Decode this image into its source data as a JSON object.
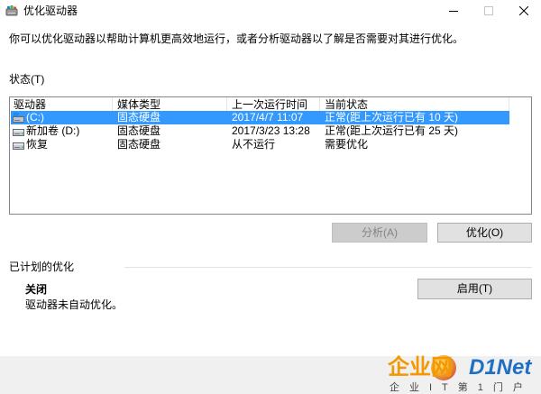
{
  "window": {
    "title": "优化驱动器",
    "icon": "optimize-drives-icon",
    "controls": [
      "minimize-icon",
      "maximize-icon",
      "close-icon"
    ]
  },
  "description": "你可以优化驱动器以帮助计算机更高效地运行，或者分析驱动器以了解是否需要对其进行优化。",
  "status": {
    "label": "状态(T)",
    "columns": [
      "驱动器",
      "媒体类型",
      "上一次运行时间",
      "当前状态"
    ],
    "drives": [
      {
        "name": "(C:)",
        "media": "固态硬盘",
        "last_run": "2017/4/7 11:07",
        "status": "正常(距上次运行已有 10 天)",
        "selected": true,
        "icon": "system-drive-icon"
      },
      {
        "name": "新加卷 (D:)",
        "media": "固态硬盘",
        "last_run": "2017/3/23 13:28",
        "status": "正常(距上次运行已有 25 天)",
        "selected": false,
        "icon": "drive-icon"
      },
      {
        "name": "恢复",
        "media": "固态硬盘",
        "last_run": "从不运行",
        "status": "需要优化",
        "selected": false,
        "icon": "drive-icon"
      }
    ],
    "analyze_button": {
      "label": "分析(A)",
      "enabled": false
    },
    "optimize_button": {
      "label": "优化(O)",
      "enabled": true
    }
  },
  "scheduled": {
    "label": "已计划的优化",
    "state": "关闭",
    "detail": "驱动器未自动优化。",
    "enable_button": {
      "label": "启用(T)"
    }
  },
  "watermark": {
    "brand_cn": "企业网",
    "brand_en": "D1Net",
    "slogan": "企业IT第1门户"
  },
  "colors": {
    "selection": "#3399ff",
    "watermark_orange": "#f39800",
    "watermark_blue": "#1f6fc5"
  }
}
